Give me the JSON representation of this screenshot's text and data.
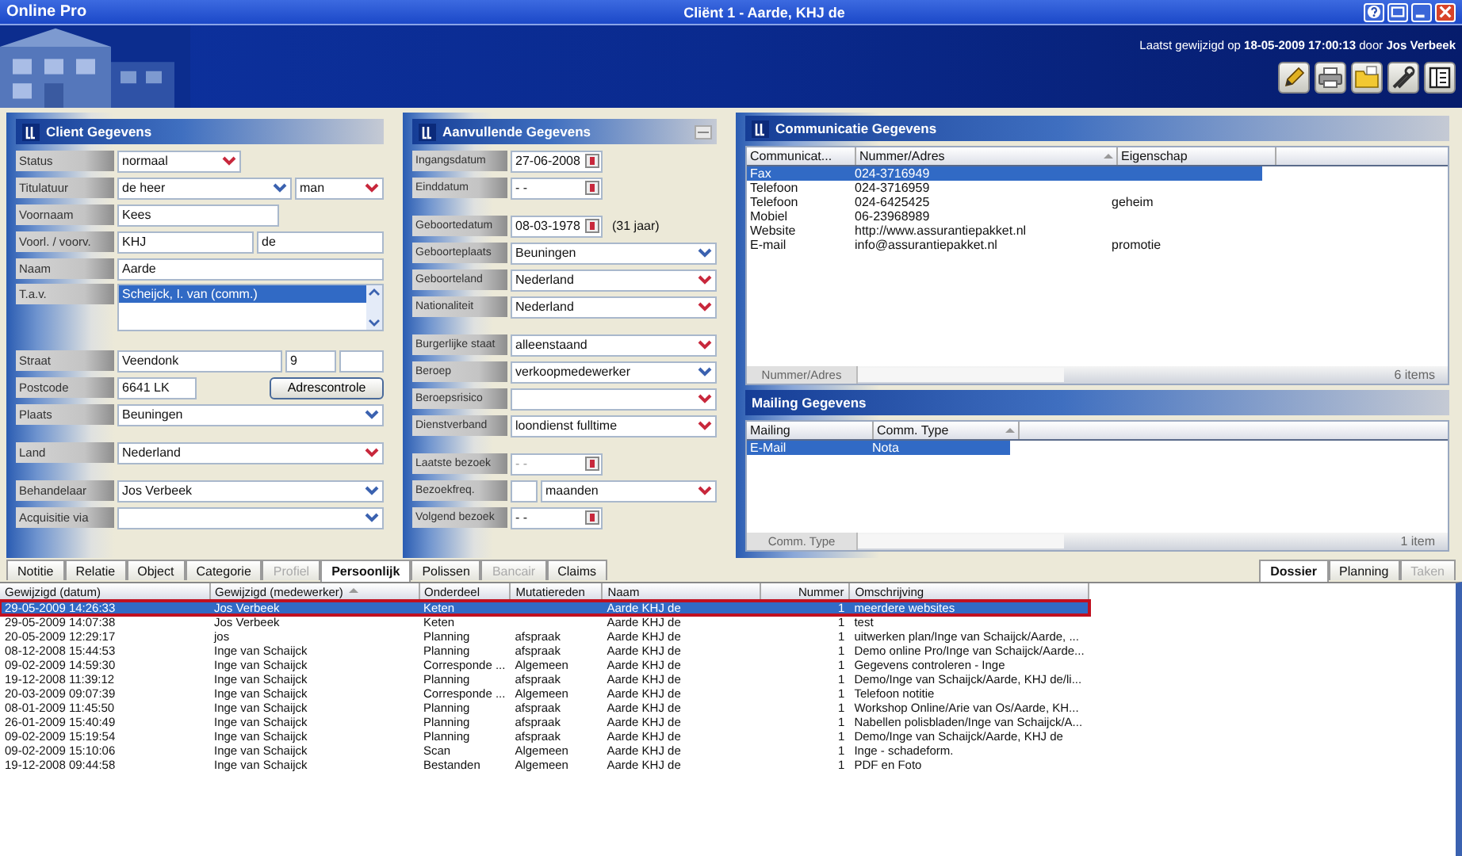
{
  "app": {
    "name": "Online Pro",
    "title": "Cliënt 1  -  Aarde, KHJ de",
    "last_changed": "Laatst gewijzigd op **18-05-2009 17:00:13** door **Jos Verbeek**"
  },
  "client": {
    "title": "Client Gegevens",
    "rows": [
      {
        "label": "Status",
        "fields": [
          {
            "kind": "select",
            "value": "normaal",
            "required": true
          }
        ]
      },
      {
        "label": "Titulatuur",
        "fields": [
          {
            "kind": "select",
            "value": "de heer",
            "required": false
          },
          {
            "kind": "select",
            "value": "man",
            "required": true
          }
        ]
      },
      {
        "label": "Voornaam",
        "fields": [
          {
            "kind": "text",
            "value": "Kees"
          }
        ]
      },
      {
        "label": "Voorl. / voorv.",
        "fields": [
          {
            "kind": "text",
            "value": "KHJ"
          },
          {
            "kind": "text",
            "value": "de"
          }
        ]
      },
      {
        "label": "Naam",
        "fields": [
          {
            "kind": "text",
            "value": "Aarde"
          }
        ]
      },
      {
        "label": "T.a.v.",
        "fields": [
          {
            "kind": "list",
            "items": [
              {
                "label": "Scheijck, I. van (comm.)",
                "selected": true
              }
            ]
          }
        ]
      },
      {
        "label": "Straat",
        "fields": [
          {
            "kind": "text",
            "value": "Veendonk"
          },
          {
            "kind": "text",
            "value": "9"
          },
          {
            "kind": "text"
          }
        ]
      },
      {
        "label": "Postcode",
        "fields": [
          {
            "kind": "text",
            "value": "6641 LK"
          },
          {
            "kind": "button",
            "value": "Adrescontrole"
          }
        ]
      },
      {
        "label": "Plaats",
        "fields": [
          {
            "kind": "select",
            "value": "Beuningen",
            "required": false
          }
        ]
      },
      {
        "label": "Land",
        "fields": [
          {
            "kind": "select",
            "value": "Nederland",
            "required": true
          }
        ]
      },
      {
        "label": "Behandelaar",
        "fields": [
          {
            "kind": "select",
            "value": "Jos Verbeek",
            "required": false
          }
        ]
      },
      {
        "label": "Acquisitie via",
        "fields": [
          {
            "kind": "select",
            "required": false
          }
        ]
      }
    ]
  },
  "extra": {
    "title": "Aanvullende Gegevens",
    "rows": [
      {
        "label": "Ingangsdatum",
        "fields": [
          {
            "kind": "date",
            "value": "27-06-2008"
          }
        ]
      },
      {
        "label": "Einddatum",
        "fields": [
          {
            "kind": "date",
            "value": "- -"
          }
        ]
      },
      {
        "label": "Geboortedatum",
        "fields": [
          {
            "kind": "date",
            "value": "08-03-1978"
          },
          {
            "kind": "note",
            "value": "(31 jaar)"
          }
        ]
      },
      {
        "label": "Geboorteplaats",
        "fields": [
          {
            "kind": "select",
            "value": "Beuningen",
            "required": false
          }
        ]
      },
      {
        "label": "Geboorteland",
        "fields": [
          {
            "kind": "select",
            "value": "Nederland",
            "required": true
          }
        ]
      },
      {
        "label": "Nationaliteit",
        "fields": [
          {
            "kind": "select",
            "value": "Nederland",
            "required": true
          }
        ]
      },
      {
        "label": "Burgerlijke staat",
        "fields": [
          {
            "kind": "select",
            "value": "alleenstaand",
            "required": true
          }
        ]
      },
      {
        "label": "Beroep",
        "fields": [
          {
            "kind": "select",
            "value": "verkoopmedewerker",
            "required": false
          }
        ]
      },
      {
        "label": "Beroepsrisico",
        "fields": [
          {
            "kind": "select",
            "required": true
          }
        ]
      },
      {
        "label": "Dienstverband",
        "fields": [
          {
            "kind": "select",
            "value": "loondienst fulltime",
            "required": true
          }
        ]
      },
      {
        "label": "Laatste bezoek",
        "fields": [
          {
            "kind": "date",
            "value": "- -",
            "disabled": true
          }
        ]
      },
      {
        "label": "Bezoekfreq.",
        "fields": [
          {
            "kind": "text"
          },
          {
            "kind": "select",
            "value": "maanden",
            "required": true
          }
        ]
      },
      {
        "label": "Volgend bezoek",
        "fields": [
          {
            "kind": "date",
            "value": "- -",
            "disabled": false
          }
        ]
      }
    ]
  },
  "communication": {
    "title": "Communicatie Gegevens",
    "columns": [
      {
        "label": "Communicat...",
        "sorted": false
      },
      {
        "label": "Nummer/Adres",
        "sorted": true
      },
      {
        "label": "Eigenschap",
        "sorted": false
      }
    ],
    "rows": [
      {
        "cells": [
          "Fax",
          "024-3716949"
        ],
        "selected": true
      },
      {
        "cells": [
          "Telefoon",
          "024-3716959"
        ],
        "selected": false
      },
      {
        "cells": [
          "Telefoon",
          "024-6425425",
          "geheim"
        ],
        "selected": false
      },
      {
        "cells": [
          "Mobiel",
          "06-23968989"
        ],
        "selected": false
      },
      {
        "cells": [
          "Website",
          "http://www.assurantiepakket.nl"
        ],
        "selected": false
      },
      {
        "cells": [
          "E-mail",
          "info@assurantiepakket.nl",
          "promotie"
        ],
        "selected": false
      }
    ],
    "footer_label": "Nummer/Adres",
    "count": "6 items"
  },
  "mailing": {
    "title": "Mailing Gegevens",
    "columns": [
      {
        "label": "Mailing",
        "sorted": false
      },
      {
        "label": "Comm. Type",
        "sorted": true
      }
    ],
    "rows": [
      {
        "cells": [
          "E-Mail",
          "Nota"
        ],
        "selected": true
      }
    ],
    "footer_label": "Comm. Type",
    "count": "1 item"
  },
  "tabs": [
    {
      "label": "Notitie",
      "selected": false,
      "disabled": false
    },
    {
      "label": "Relatie",
      "selected": false,
      "disabled": false
    },
    {
      "label": "Object",
      "selected": false,
      "disabled": false
    },
    {
      "label": "Categorie",
      "selected": false,
      "disabled": false
    },
    {
      "label": "Profiel",
      "selected": false,
      "disabled": true
    },
    {
      "label": "Persoonlijk",
      "selected": true,
      "disabled": false
    },
    {
      "label": "Polissen",
      "selected": false,
      "disabled": false
    },
    {
      "label": "Bancair",
      "selected": false,
      "disabled": true
    },
    {
      "label": "Claims",
      "selected": false,
      "disabled": false
    }
  ],
  "view_tabs": [
    {
      "label": "Dossier",
      "selected": true,
      "disabled": false
    },
    {
      "label": "Planning",
      "selected": false,
      "disabled": false
    },
    {
      "label": "Taken",
      "selected": false,
      "disabled": true
    }
  ],
  "table": {
    "columns": [
      {
        "label": "Gewijzigd (datum)",
        "sorted": false
      },
      {
        "label": "Gewijzigd (medewerker)",
        "sorted": true
      },
      {
        "label": "Onderdeel",
        "sorted": false
      },
      {
        "label": "Mutatiereden",
        "sorted": false
      },
      {
        "label": "Naam",
        "sorted": false
      },
      {
        "label": "Nummer",
        "sorted": false
      },
      {
        "label": "Omschrijving",
        "sorted": false
      }
    ],
    "rows": [
      {
        "cells": [
          "29-05-2009 14:26:33",
          "Jos Verbeek",
          "Keten",
          "",
          "Aarde KHJ de",
          "1",
          "meerdere websites"
        ],
        "selected": true
      },
      {
        "cells": [
          "29-05-2009 14:07:38",
          "Jos Verbeek",
          "Keten",
          "",
          "Aarde KHJ de",
          "1",
          "test"
        ],
        "selected": false
      },
      {
        "cells": [
          "20-05-2009 12:29:17",
          "jos",
          "Planning",
          "afspraak",
          "Aarde KHJ de",
          "1",
          "uitwerken plan/Inge van Schaijck/Aarde, ..."
        ],
        "selected": false
      },
      {
        "cells": [
          "08-12-2008 15:44:53",
          "Inge van Schaijck",
          "Planning",
          "afspraak",
          "Aarde KHJ de",
          "1",
          "Demo online Pro/Inge van Schaijck/Aarde..."
        ],
        "selected": false
      },
      {
        "cells": [
          "09-02-2009 14:59:30",
          "Inge van Schaijck",
          "Corresponde ...",
          "Algemeen",
          "Aarde KHJ de",
          "1",
          "Gegevens controleren - Inge"
        ],
        "selected": false
      },
      {
        "cells": [
          "19-12-2008 11:39:12",
          "Inge van Schaijck",
          "Planning",
          "afspraak",
          "Aarde KHJ de",
          "1",
          "Demo/Inge van Schaijck/Aarde, KHJ de/li..."
        ],
        "selected": false
      },
      {
        "cells": [
          "20-03-2009 09:07:39",
          "Inge van Schaijck",
          "Corresponde ...",
          "Algemeen",
          "Aarde KHJ de",
          "1",
          "Telefoon notitie"
        ],
        "selected": false
      },
      {
        "cells": [
          "08-01-2009 11:45:50",
          "Inge van Schaijck",
          "Planning",
          "afspraak",
          "Aarde KHJ de",
          "1",
          "Workshop Online/Arie van Os/Aarde, KH..."
        ],
        "selected": false
      },
      {
        "cells": [
          "26-01-2009 15:40:49",
          "Inge van Schaijck",
          "Planning",
          "afspraak",
          "Aarde KHJ de",
          "1",
          "Nabellen polisbladen/Inge van Schaijck/A..."
        ],
        "selected": false
      },
      {
        "cells": [
          "09-02-2009 15:19:54",
          "Inge van Schaijck",
          "Planning",
          "afspraak",
          "Aarde KHJ de",
          "1",
          "Demo/Inge van Schaijck/Aarde, KHJ de"
        ],
        "selected": false
      },
      {
        "cells": [
          "09-02-2009 15:10:06",
          "Inge van Schaijck",
          "Scan",
          "Algemeen",
          "Aarde KHJ de",
          "1",
          "Inge - schadeform."
        ],
        "selected": false
      },
      {
        "cells": [
          "19-12-2008 09:44:58",
          "Inge van Schaijck",
          "Bestanden",
          "Algemeen",
          "Aarde KHJ de",
          "1",
          "PDF en Foto"
        ],
        "selected": false
      }
    ]
  }
}
